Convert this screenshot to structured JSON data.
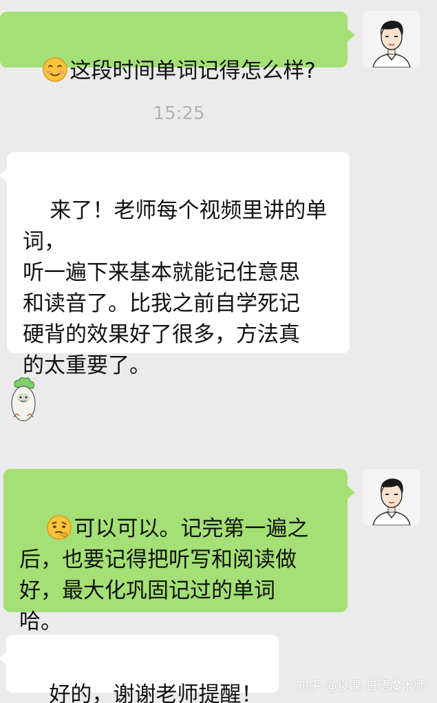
{
  "messages": [
    {
      "text": "这段时间单词记得怎么样?",
      "icon": "smiling-blush-emoji"
    },
    {
      "time": "15:25"
    },
    {
      "text": "来了！老师每个视频里讲的单\n词，\n听一遍下来基本就能记住意思\n和读音了。比我之前自学死记\n硬背的效果好了很多，方法真\n的太重要了。"
    },
    {
      "icon": "cabbage-head-sticker"
    },
    {
      "text": "可以可以。记完第一遍之\n后，也要记得把听写和阅读做\n好，最大化巩固记过的单词\n哈。",
      "icon": "thinking-emoji"
    },
    {
      "text": "好的，谢谢老师提醒！"
    }
  ],
  "watermark": "知乎 @良课-日语魔术师",
  "colors": {
    "background": "#ebebeb",
    "outgoing_bubble": "#a4e075",
    "incoming_bubble": "#ffffff",
    "timestamp": "#b2b2b2"
  }
}
